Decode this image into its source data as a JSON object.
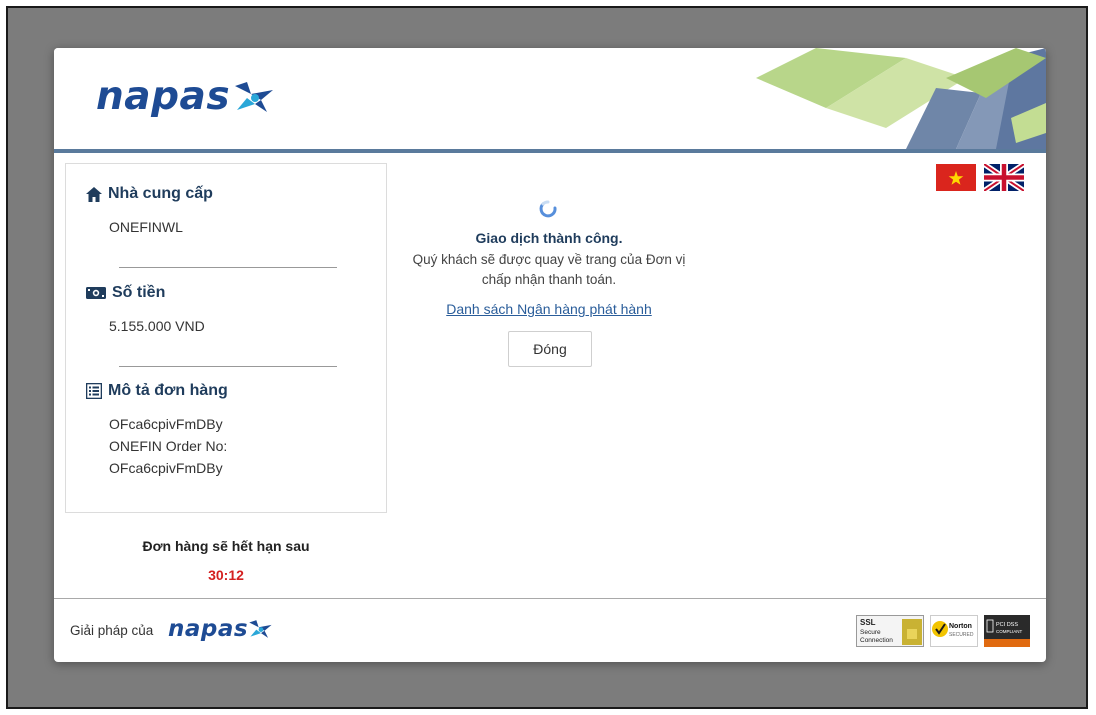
{
  "brand": {
    "name": "napas",
    "accent": "#1e4b94"
  },
  "provider": {
    "title": "Nhà cung cấp",
    "value": "ONEFINWL"
  },
  "amount": {
    "title": "Số tiền",
    "value": "5.155.000 VND"
  },
  "order": {
    "title": "Mô tả đơn hàng",
    "lines": [
      "OFca6cpivFmDBy",
      "ONEFIN Order No:",
      "OFca6cpivFmDBy"
    ]
  },
  "expire": {
    "label": "Đơn hàng sẽ hết hạn sau",
    "countdown": "30:12"
  },
  "status": {
    "title": "Giao dịch thành công.",
    "message_line1": "Quý khách sẽ được quay về trang của Đơn vị",
    "message_line2": "chấp nhận thanh toán.",
    "banks_link": "Danh sách Ngân hàng phát hành",
    "close_label": "Đóng"
  },
  "footer": {
    "prefix": "Giải pháp của",
    "brand": "napas"
  },
  "badges": {
    "ssl": [
      "SSL",
      "Secure",
      "Connection"
    ],
    "norton": "Norton",
    "norton_sub": "SECURED",
    "pci": "PCI DSS",
    "pci_sub": "COMPLIANT"
  },
  "icons": {
    "provider": "home-icon",
    "amount": "money-icon",
    "order": "list-icon",
    "lang_vi": "flag-vietnam-icon",
    "lang_en": "flag-uk-icon"
  }
}
